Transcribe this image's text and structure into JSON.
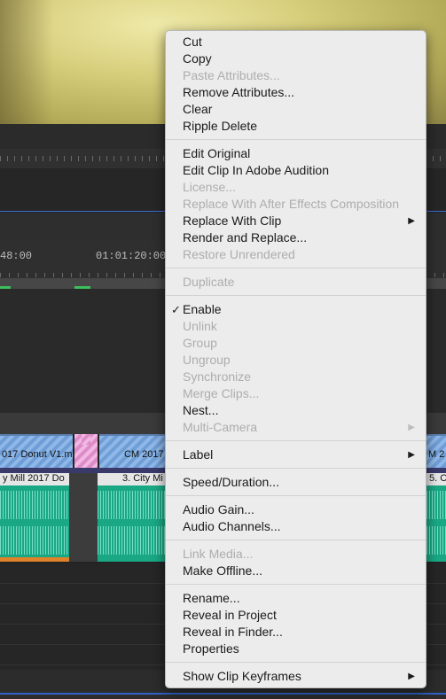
{
  "timeline": {
    "timecode_left": "48:00",
    "timecode_mid": "01:01:20:00",
    "video_clips": [
      {
        "label": "017 Donut V1.m"
      },
      {
        "label": "CM 2017"
      },
      {
        "label": "M 2"
      }
    ],
    "audio_clips": [
      {
        "label": "y Mill 2017 Do"
      },
      {
        "label": "3. City Mi"
      },
      {
        "label": "5. C"
      }
    ]
  },
  "context_menu": {
    "groups": [
      [
        {
          "label": "Cut",
          "enabled": true
        },
        {
          "label": "Copy",
          "enabled": true
        },
        {
          "label": "Paste Attributes...",
          "enabled": false
        },
        {
          "label": "Remove Attributes...",
          "enabled": true
        },
        {
          "label": "Clear",
          "enabled": true
        },
        {
          "label": "Ripple Delete",
          "enabled": true
        }
      ],
      [
        {
          "label": "Edit Original",
          "enabled": true
        },
        {
          "label": "Edit Clip In Adobe Audition",
          "enabled": true
        },
        {
          "label": "License...",
          "enabled": false
        },
        {
          "label": "Replace With After Effects Composition",
          "enabled": false
        },
        {
          "label": "Replace With Clip",
          "enabled": true,
          "submenu": true
        },
        {
          "label": "Render and Replace...",
          "enabled": true
        },
        {
          "label": "Restore Unrendered",
          "enabled": false
        }
      ],
      [
        {
          "label": "Duplicate",
          "enabled": false
        }
      ],
      [
        {
          "label": "Enable",
          "enabled": true,
          "checked": true
        },
        {
          "label": "Unlink",
          "enabled": false
        },
        {
          "label": "Group",
          "enabled": false
        },
        {
          "label": "Ungroup",
          "enabled": false
        },
        {
          "label": "Synchronize",
          "enabled": false
        },
        {
          "label": "Merge Clips...",
          "enabled": false
        },
        {
          "label": "Nest...",
          "enabled": true
        },
        {
          "label": "Multi-Camera",
          "enabled": false,
          "submenu": true
        }
      ],
      [
        {
          "label": "Label",
          "enabled": true,
          "submenu": true
        }
      ],
      [
        {
          "label": "Speed/Duration...",
          "enabled": true
        }
      ],
      [
        {
          "label": "Audio Gain...",
          "enabled": true
        },
        {
          "label": "Audio Channels...",
          "enabled": true
        }
      ],
      [
        {
          "label": "Link Media...",
          "enabled": false
        },
        {
          "label": "Make Offline...",
          "enabled": true
        }
      ],
      [
        {
          "label": "Rename...",
          "enabled": true
        },
        {
          "label": "Reveal in Project",
          "enabled": true
        },
        {
          "label": "Reveal in Finder...",
          "enabled": true
        },
        {
          "label": "Properties",
          "enabled": true
        }
      ],
      [
        {
          "label": "Show Clip Keyframes",
          "enabled": true,
          "submenu": true
        }
      ]
    ]
  }
}
